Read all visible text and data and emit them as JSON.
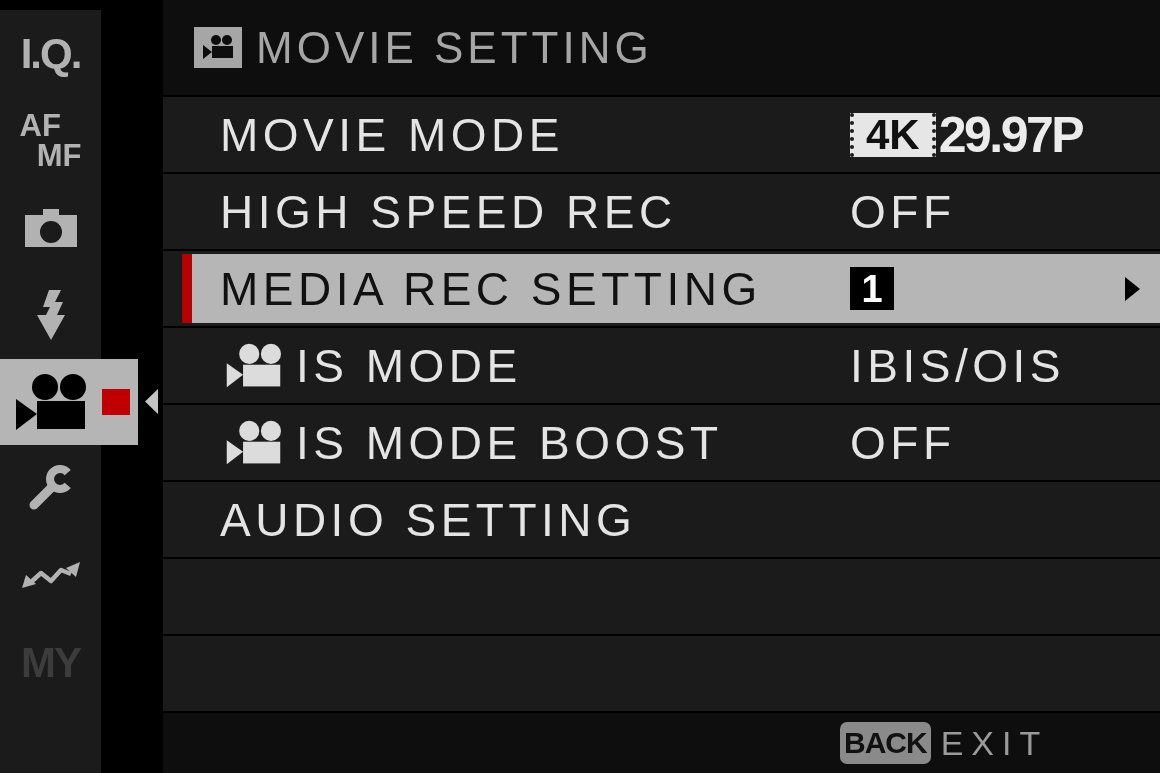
{
  "sidebar": {
    "items": [
      {
        "kind": "text",
        "label": "I.Q.",
        "selected": false,
        "disabled": false
      },
      {
        "kind": "stacked",
        "lines": [
          "AF",
          "MF"
        ],
        "selected": false,
        "disabled": false
      },
      {
        "kind": "camera",
        "selected": false,
        "disabled": false
      },
      {
        "kind": "flash",
        "selected": false,
        "disabled": false
      },
      {
        "kind": "movie",
        "selected": true,
        "disabled": false
      },
      {
        "kind": "wrench",
        "selected": false,
        "disabled": false
      },
      {
        "kind": "connection",
        "selected": false,
        "disabled": false
      },
      {
        "kind": "text",
        "label": "MY",
        "selected": false,
        "disabled": true
      }
    ]
  },
  "header": {
    "title": "MOVIE SETTING"
  },
  "menu": {
    "items": [
      {
        "kind": "plain",
        "label": "MOVIE MODE",
        "selected": false,
        "value": {
          "kind": "resolution",
          "badge": "4K",
          "text": "29.97P"
        }
      },
      {
        "kind": "plain",
        "label": "HIGH SPEED REC",
        "selected": false,
        "value": {
          "kind": "plain",
          "text": "OFF"
        }
      },
      {
        "kind": "plain",
        "label": "MEDIA REC SETTING",
        "selected": true,
        "value": {
          "kind": "slot",
          "text": "1"
        }
      },
      {
        "kind": "movie",
        "label": "IS MODE",
        "selected": false,
        "value": {
          "kind": "plain",
          "text": "IBIS/OIS"
        }
      },
      {
        "kind": "movie",
        "label": "IS MODE BOOST",
        "selected": false,
        "value": {
          "kind": "plain",
          "text": "OFF"
        }
      },
      {
        "kind": "plain",
        "label": "AUDIO SETTING",
        "selected": false
      }
    ]
  },
  "footer": {
    "key": "BACK",
    "label": "EXIT"
  }
}
